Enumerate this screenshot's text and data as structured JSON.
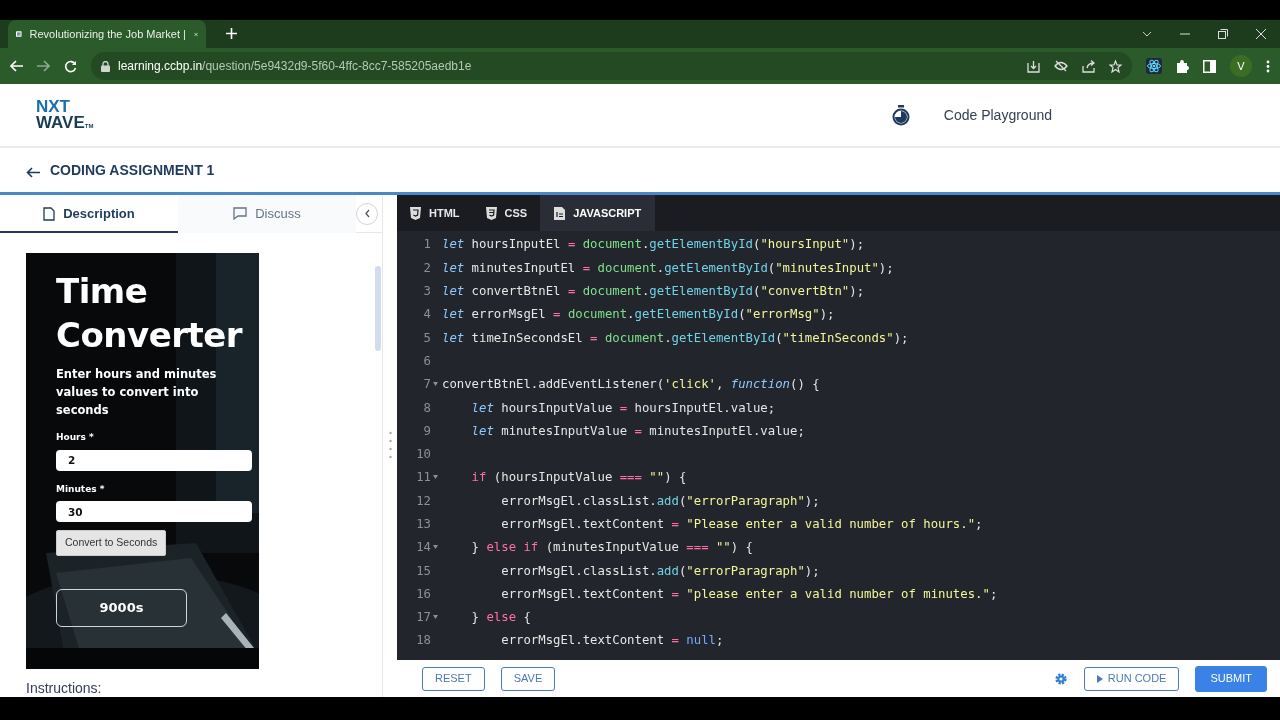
{
  "browser": {
    "tab_title": "Revolutionizing the Job Market |",
    "url_host": "learning.ccbp.in",
    "url_path": "/question/5e9432d9-5f60-4ffc-8cc7-585205aedb1e",
    "profile_initial": "V"
  },
  "header": {
    "logo": {
      "line1": "NXT",
      "line2": "WAVE",
      "mark": "TM"
    },
    "playground_label": "Code Playground"
  },
  "assignment": {
    "title": "CODING ASSIGNMENT 1"
  },
  "left_tabs": [
    {
      "label": "Description",
      "selected": true
    },
    {
      "label": "Discuss",
      "selected": false
    }
  ],
  "preview": {
    "heading": "Time Converter",
    "description": "Enter hours and minutes values to convert into seconds",
    "fields": [
      {
        "label": "Hours *",
        "value": "2"
      },
      {
        "label": "Minutes *",
        "value": "30"
      }
    ],
    "button": "Convert to Seconds",
    "result": "9000s"
  },
  "instructions_heading": "Instructions:",
  "editor_tabs": [
    {
      "label": "HTML",
      "kind": "html",
      "selected": false
    },
    {
      "label": "CSS",
      "kind": "css",
      "selected": false
    },
    {
      "label": "JAVASCRIPT",
      "kind": "js",
      "selected": true
    }
  ],
  "code_lines": [
    {
      "number": "1",
      "foldable": false,
      "tokens": [
        {
          "text": "let",
          "kind": "keyword"
        },
        {
          "text": " hoursInputEl ",
          "kind": "plain"
        },
        {
          "text": "= ",
          "kind": "operator"
        },
        {
          "text": "document",
          "kind": "object"
        },
        {
          "text": ".",
          "kind": "plain"
        },
        {
          "text": "getElementById",
          "kind": "method"
        },
        {
          "text": "(",
          "kind": "plain"
        },
        {
          "text": "\"hoursInput\"",
          "kind": "string"
        },
        {
          "text": ");",
          "kind": "plain"
        }
      ]
    },
    {
      "number": "2",
      "foldable": false,
      "tokens": [
        {
          "text": "let",
          "kind": "keyword"
        },
        {
          "text": " minutesInputEl ",
          "kind": "plain"
        },
        {
          "text": "= ",
          "kind": "operator"
        },
        {
          "text": "document",
          "kind": "object"
        },
        {
          "text": ".",
          "kind": "plain"
        },
        {
          "text": "getElementById",
          "kind": "method"
        },
        {
          "text": "(",
          "kind": "plain"
        },
        {
          "text": "\"minutesInput\"",
          "kind": "string"
        },
        {
          "text": ");",
          "kind": "plain"
        }
      ]
    },
    {
      "number": "3",
      "foldable": false,
      "tokens": [
        {
          "text": "let",
          "kind": "keyword"
        },
        {
          "text": " convertBtnEl ",
          "kind": "plain"
        },
        {
          "text": "= ",
          "kind": "operator"
        },
        {
          "text": "document",
          "kind": "object"
        },
        {
          "text": ".",
          "kind": "plain"
        },
        {
          "text": "getElementById",
          "kind": "method"
        },
        {
          "text": "(",
          "kind": "plain"
        },
        {
          "text": "\"convertBtn\"",
          "kind": "string"
        },
        {
          "text": ");",
          "kind": "plain"
        }
      ]
    },
    {
      "number": "4",
      "foldable": false,
      "tokens": [
        {
          "text": "let",
          "kind": "keyword"
        },
        {
          "text": " errorMsgEl ",
          "kind": "plain"
        },
        {
          "text": "= ",
          "kind": "operator"
        },
        {
          "text": "document",
          "kind": "object"
        },
        {
          "text": ".",
          "kind": "plain"
        },
        {
          "text": "getElementById",
          "kind": "method"
        },
        {
          "text": "(",
          "kind": "plain"
        },
        {
          "text": "\"errorMsg\"",
          "kind": "string"
        },
        {
          "text": ");",
          "kind": "plain"
        }
      ]
    },
    {
      "number": "5",
      "foldable": false,
      "tokens": [
        {
          "text": "let",
          "kind": "keyword"
        },
        {
          "text": " timeInSecondsEl ",
          "kind": "plain"
        },
        {
          "text": "= ",
          "kind": "operator"
        },
        {
          "text": "document",
          "kind": "object"
        },
        {
          "text": ".",
          "kind": "plain"
        },
        {
          "text": "getElementById",
          "kind": "method"
        },
        {
          "text": "(",
          "kind": "plain"
        },
        {
          "text": "\"timeInSeconds\"",
          "kind": "string"
        },
        {
          "text": ");",
          "kind": "plain"
        }
      ]
    },
    {
      "number": "6",
      "foldable": false
    },
    {
      "number": "7",
      "foldable": true,
      "tokens": [
        {
          "text": "convertBtnEl.addEventListener(",
          "kind": "plain"
        },
        {
          "text": "'click'",
          "kind": "string"
        },
        {
          "text": ", ",
          "kind": "plain"
        },
        {
          "text": "function",
          "kind": "keyword"
        },
        {
          "text": "() {",
          "kind": "plain"
        }
      ]
    },
    {
      "number": "8",
      "foldable": false,
      "tokens": [
        {
          "text": "    let",
          "kind": "keyword"
        },
        {
          "text": " hoursInputValue ",
          "kind": "plain"
        },
        {
          "text": "=",
          "kind": "operator"
        },
        {
          "text": " hoursInputEl.value;",
          "kind": "plain"
        }
      ]
    },
    {
      "number": "9",
      "foldable": false,
      "tokens": [
        {
          "text": "    let",
          "kind": "keyword"
        },
        {
          "text": " minutesInputValue ",
          "kind": "plain"
        },
        {
          "text": "=",
          "kind": "operator"
        },
        {
          "text": " minutesInputEl.value;",
          "kind": "plain"
        }
      ]
    },
    {
      "number": "10",
      "foldable": false
    },
    {
      "number": "11",
      "foldable": true,
      "tokens": [
        {
          "text": "    if",
          "kind": "control"
        },
        {
          "text": " (hoursInputValue ",
          "kind": "plain"
        },
        {
          "text": "=== ",
          "kind": "operator"
        },
        {
          "text": "\"\"",
          "kind": "string"
        },
        {
          "text": ") {",
          "kind": "plain"
        }
      ]
    },
    {
      "number": "12",
      "foldable": false,
      "tokens": [
        {
          "text": "        errorMsgEl.classList.",
          "kind": "plain"
        },
        {
          "text": "add",
          "kind": "method"
        },
        {
          "text": "(",
          "kind": "plain"
        },
        {
          "text": "\"errorParagraph\"",
          "kind": "string"
        },
        {
          "text": ");",
          "kind": "plain"
        }
      ]
    },
    {
      "number": "13",
      "foldable": false,
      "tokens": [
        {
          "text": "        errorMsgEl.textContent ",
          "kind": "plain"
        },
        {
          "text": "= ",
          "kind": "operator"
        },
        {
          "text": "\"Please enter a valid number of hours.\"",
          "kind": "string"
        },
        {
          "text": ";",
          "kind": "plain"
        }
      ]
    },
    {
      "number": "14",
      "foldable": true,
      "tokens": [
        {
          "text": "    } ",
          "kind": "plain"
        },
        {
          "text": "else if",
          "kind": "control"
        },
        {
          "text": " (minutesInputValue ",
          "kind": "plain"
        },
        {
          "text": "=== ",
          "kind": "operator"
        },
        {
          "text": "\"\"",
          "kind": "string"
        },
        {
          "text": ") {",
          "kind": "plain"
        }
      ]
    },
    {
      "number": "15",
      "foldable": false,
      "tokens": [
        {
          "text": "        errorMsgEl.classList.",
          "kind": "plain"
        },
        {
          "text": "add",
          "kind": "method"
        },
        {
          "text": "(",
          "kind": "plain"
        },
        {
          "text": "\"errorParagraph\"",
          "kind": "string"
        },
        {
          "text": ");",
          "kind": "plain"
        }
      ]
    },
    {
      "number": "16",
      "foldable": false,
      "tokens": [
        {
          "text": "        errorMsgEl.textContent ",
          "kind": "plain"
        },
        {
          "text": "= ",
          "kind": "operator"
        },
        {
          "text": "\"please enter a valid number of minutes.\"",
          "kind": "string"
        },
        {
          "text": ";",
          "kind": "plain"
        }
      ]
    },
    {
      "number": "17",
      "foldable": true,
      "tokens": [
        {
          "text": "    } ",
          "kind": "plain"
        },
        {
          "text": "else",
          "kind": "control"
        },
        {
          "text": " {",
          "kind": "plain"
        }
      ]
    },
    {
      "number": "18",
      "foldable": false,
      "tokens": [
        {
          "text": "        errorMsgEl.textContent ",
          "kind": "plain"
        },
        {
          "text": "= ",
          "kind": "operator"
        },
        {
          "text": "null",
          "kind": "literal"
        },
        {
          "text": ";",
          "kind": "plain"
        }
      ]
    }
  ],
  "footer_buttons": [
    {
      "label": "RESET",
      "kind": "outline"
    },
    {
      "label": "SAVE",
      "kind": "outline"
    },
    {
      "kind": "settings"
    },
    {
      "label": "RUN CODE",
      "kind": "run"
    },
    {
      "label": "SUBMIT",
      "kind": "primary"
    }
  ]
}
